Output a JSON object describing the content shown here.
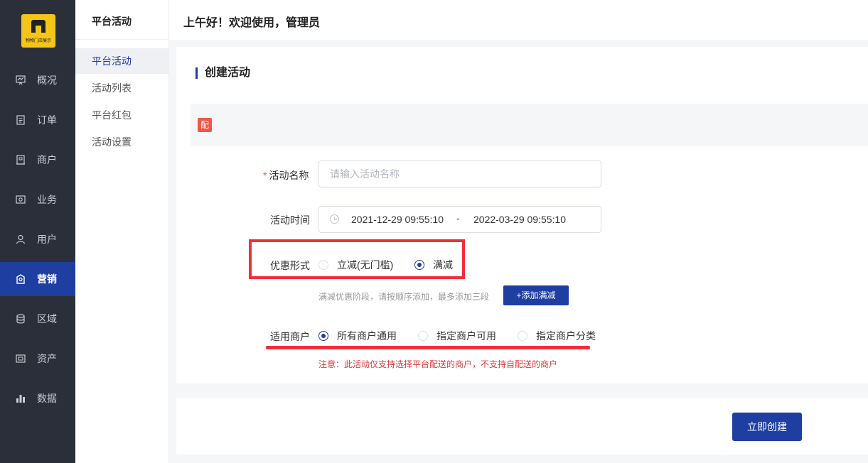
{
  "logo": {
    "text": "物物门店展示"
  },
  "nav": {
    "items": [
      {
        "label": "概况",
        "icon": "chart-board-icon"
      },
      {
        "label": "订单",
        "icon": "document-icon"
      },
      {
        "label": "商户",
        "icon": "building-icon"
      },
      {
        "label": "业务",
        "icon": "briefcase-icon"
      },
      {
        "label": "用户",
        "icon": "user-icon"
      },
      {
        "label": "营销",
        "icon": "tag-icon"
      },
      {
        "label": "区域",
        "icon": "database-icon"
      },
      {
        "label": "资产",
        "icon": "wallet-icon"
      },
      {
        "label": "数据",
        "icon": "bar-chart-icon"
      }
    ],
    "active": "营销"
  },
  "subnav": {
    "title": "平台活动",
    "items": [
      "平台活动",
      "活动列表",
      "平台红包",
      "活动设置"
    ],
    "active": "平台活动"
  },
  "header": {
    "greeting": "上午好！欢迎使用，管理员"
  },
  "form": {
    "title": "创建活动",
    "badge": "配",
    "name_label": "活动名称",
    "name_placeholder": "请输入活动名称",
    "time_label": "活动时间",
    "start_date": "2021-12-29 09:55:10",
    "date_sep": "-",
    "end_date": "2022-03-29 09:55:10",
    "discount_label": "优惠形式",
    "discount_options": [
      "立减(无门槛)",
      "满减"
    ],
    "discount_selected": "满减",
    "hint": "满减优惠阶段，请按顺序添加，最多添加三段",
    "add_button": "+添加满减",
    "merchant_label": "适用商户",
    "merchant_options": [
      "所有商户通用",
      "指定商户可用",
      "指定商户分类"
    ],
    "merchant_selected": "所有商户通用",
    "notice": "注意：此活动仅支持选择平台配送的商户，不支持自配送的商户",
    "submit": "立即创建"
  },
  "colors": {
    "accent": "#1e3ea1",
    "sidebar": "#2b2f3a",
    "highlight": "#f03038",
    "logo": "#f5c518"
  }
}
